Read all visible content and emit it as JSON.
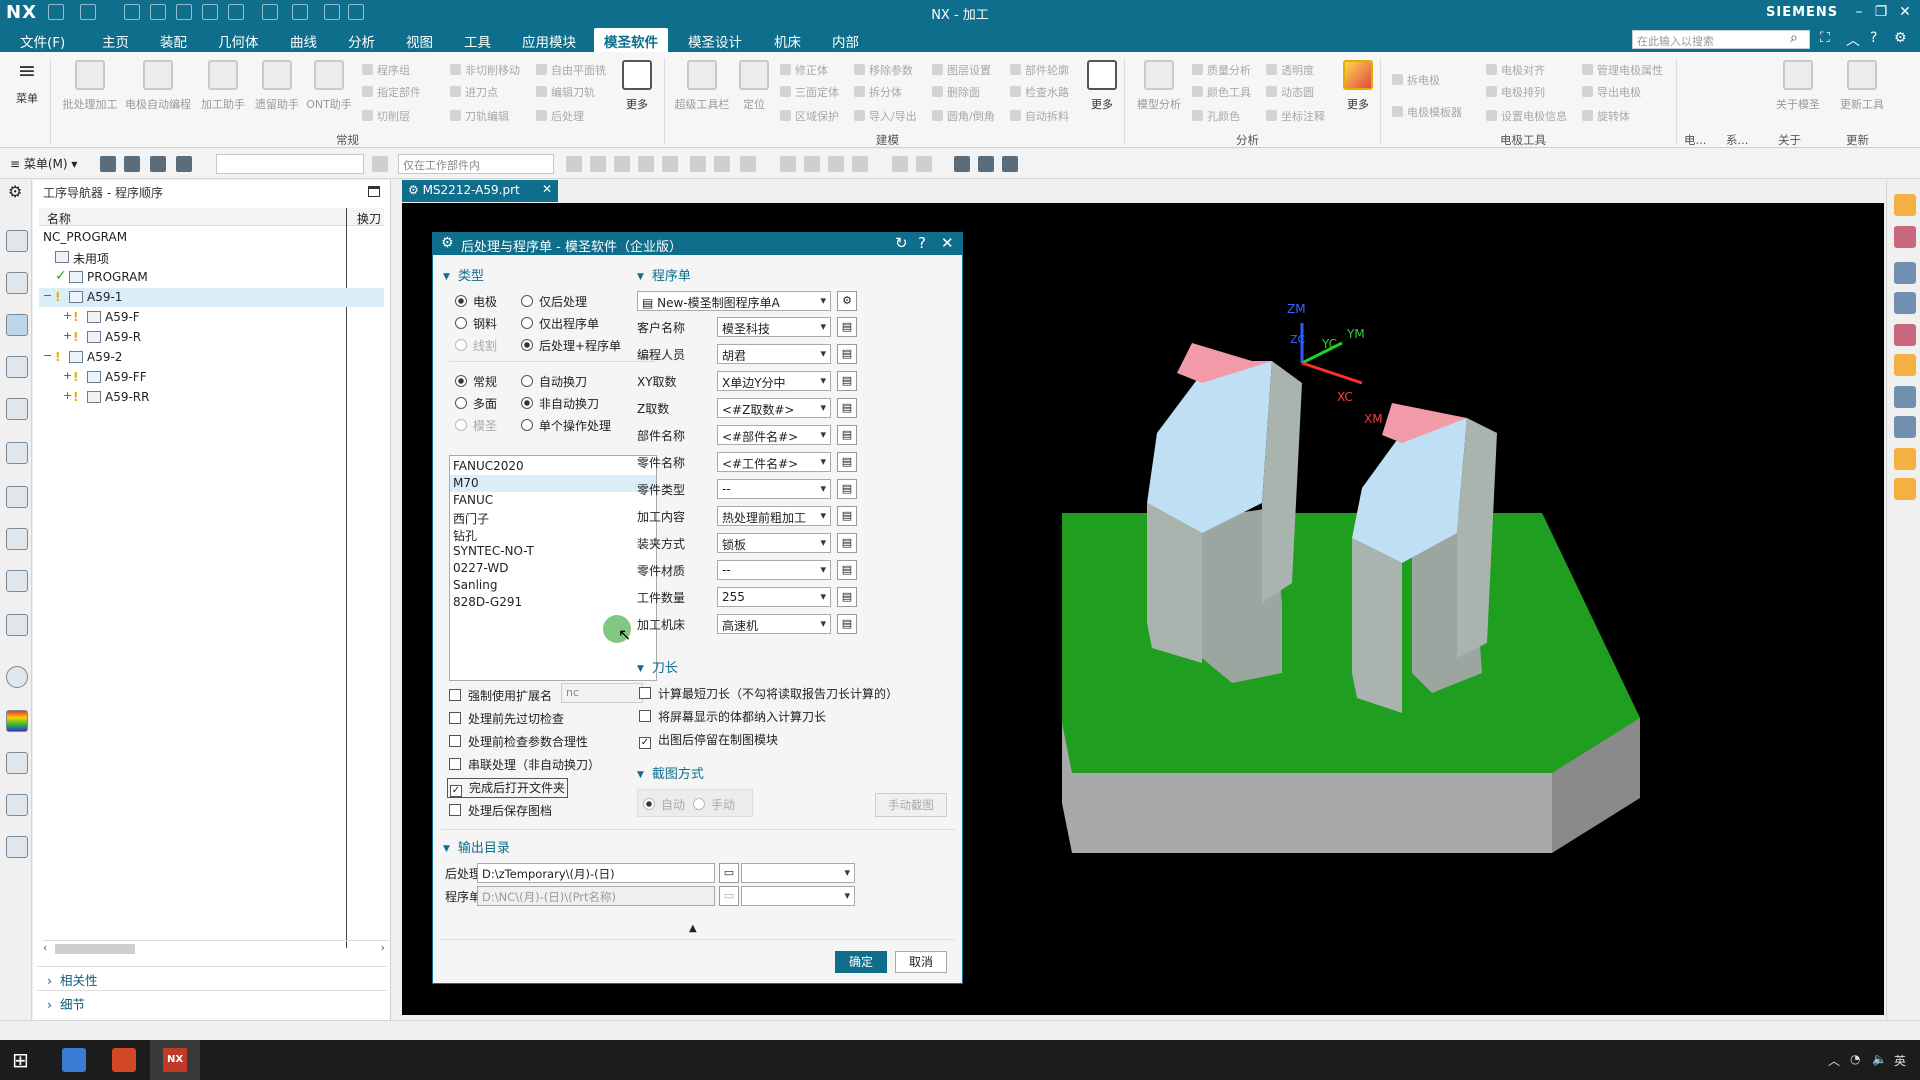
{
  "app": {
    "logo": "NX",
    "title": "NX - 加工",
    "brand": "SIEMENS"
  },
  "menu": {
    "items": [
      "文件(F)",
      "主页",
      "装配",
      "几何体",
      "曲线",
      "分析",
      "视图",
      "工具",
      "应用模块",
      "模圣软件",
      "模圣设计",
      "机床",
      "内部"
    ],
    "active": "模圣软件",
    "search_placeholder": "在此输入以搜索"
  },
  "ribbon": {
    "menu_label": "菜单",
    "big_buttons": [
      "批处理加工",
      "电极自动编程",
      "加工助手",
      "遗留助手",
      "ONT助手"
    ],
    "small_col1": [
      "程序组",
      "指定部件",
      "切削层"
    ],
    "small_col2": [
      "非切削移动",
      "进刀点",
      "刀轨编辑"
    ],
    "small_col3": [
      "自由平面铣",
      "编辑刀轨",
      "后处理"
    ],
    "more": "更多",
    "groups": [
      "常规",
      "建模",
      "分析",
      "电极工具",
      "电...",
      "系...",
      "关于",
      "更新"
    ],
    "modeling": [
      "超级工具栏",
      "定位"
    ],
    "modeling_small": [
      "修正体",
      "三面定体",
      "区域保护",
      "移除参数",
      "拆分体",
      "导入/导出",
      "图层设置",
      "删除面",
      "圆角/倒角",
      "部件轮廓",
      "检查水路",
      "自动拆料"
    ],
    "analysis": [
      "模型分析",
      "质量分析",
      "颜色工具",
      "孔颜色",
      "透明度",
      "动态圆",
      "坐标注释"
    ],
    "electrode": [
      "拆电极",
      "电极模板器",
      "电极对齐",
      "电极排列",
      "设置电极信息",
      "管理电极属性",
      "导出电极",
      "旋转体"
    ],
    "about": "关于模圣",
    "update": "更新工具"
  },
  "toolbar2": {
    "menu": "菜单(M)",
    "filter": "仅在工作部件内"
  },
  "navigator": {
    "title": "工序导航器 - 程序顺序",
    "col_name": "名称",
    "col_tool": "换刀",
    "rows": [
      {
        "label": "NC_PROGRAM"
      },
      {
        "label": "未用项"
      },
      {
        "label": "PROGRAM"
      },
      {
        "label": "A59-1"
      },
      {
        "label": "A59-F"
      },
      {
        "label": "A59-R"
      },
      {
        "label": "A59-2"
      },
      {
        "label": "A59-FF"
      },
      {
        "label": "A59-RR"
      }
    ],
    "footer": [
      "相关性",
      "细节"
    ]
  },
  "doc_tab": "MS2212-A59.prt",
  "dialog": {
    "title": "后处理与程序单 - 模圣软件（企业版）",
    "sections": {
      "type": "类型",
      "program_sheet": "程序单",
      "tool_length": "刀长",
      "screenshot": "截图方式",
      "output": "输出目录"
    },
    "type_radios": {
      "row1": [
        "电极",
        "仅后处理"
      ],
      "row2": [
        "钢料",
        "仅出程序单"
      ],
      "row3": [
        "线割",
        "后处理+程序单"
      ],
      "row4": [
        "常规",
        "自动换刀"
      ],
      "row5": [
        "多面",
        "非自动换刀"
      ],
      "row6": [
        "模圣",
        "单个操作处理"
      ]
    },
    "post_list": [
      "FANUC2020",
      "M70",
      "FANUC",
      "西门子",
      "钻孔",
      "SYNTEC-NO-T",
      "0227-WD",
      "Sanling",
      "828D-G291"
    ],
    "post_selected": "M70",
    "options": [
      {
        "label": "强制使用扩展名",
        "checked": false
      },
      {
        "label": "处理前先过切检查",
        "checked": false
      },
      {
        "label": "处理前检查参数合理性",
        "checked": false
      },
      {
        "label": "串联处理（非自动换刀）",
        "checked": false
      },
      {
        "label": "完成后打开文件夹",
        "checked": true
      },
      {
        "label": "处理后保存图档",
        "checked": false
      }
    ],
    "ext_value": "nc",
    "sheet_template": "New-模圣制图程序单A",
    "fields": [
      {
        "label": "客户名称",
        "value": "模圣科技"
      },
      {
        "label": "编程人员",
        "value": "胡君"
      },
      {
        "label": "XY取数",
        "value": "X单边Y分中"
      },
      {
        "label": "Z取数",
        "value": "<#Z取数#>"
      },
      {
        "label": "部件名称",
        "value": "<#部件名#>"
      },
      {
        "label": "零件名称",
        "value": "<#工件名#>"
      },
      {
        "label": "零件类型",
        "value": "--"
      },
      {
        "label": "加工内容",
        "value": "热处理前粗加工"
      },
      {
        "label": "装夹方式",
        "value": "锁板"
      },
      {
        "label": "零件材质",
        "value": "--"
      },
      {
        "label": "工件数量",
        "value": "255"
      },
      {
        "label": "加工机床",
        "value": "高速机"
      }
    ],
    "tool_options": [
      {
        "label": "计算最短刀长（不勾将读取报告刀长计算的）",
        "checked": false
      },
      {
        "label": "将屏幕显示的体都纳入计算刀长",
        "checked": false
      },
      {
        "label": "出图后停留在制图模块",
        "checked": true
      }
    ],
    "shot_radios": [
      "自动",
      "手动"
    ],
    "shot_button": "手动截图",
    "output": {
      "post_label": "后处理",
      "post_path": "D:\\zTemporary\\(月)-(日)",
      "sheet_label": "程序单",
      "sheet_path": "D:\\NC\\(月)-(日)\\(Prt名称)"
    },
    "ok": "确定",
    "cancel": "取消"
  },
  "viewport": {
    "axes": [
      "ZM",
      "ZC",
      "YC",
      "YM",
      "XC",
      "XM"
    ]
  },
  "taskbar": {
    "tray": [
      "英"
    ]
  },
  "colors": {
    "accent": "#0e6e8c",
    "base_green": "#1e9e1e",
    "face_blue": "#bfe0f4",
    "face_pink": "#f29aa8",
    "side_gray": "#a9b4ae"
  }
}
